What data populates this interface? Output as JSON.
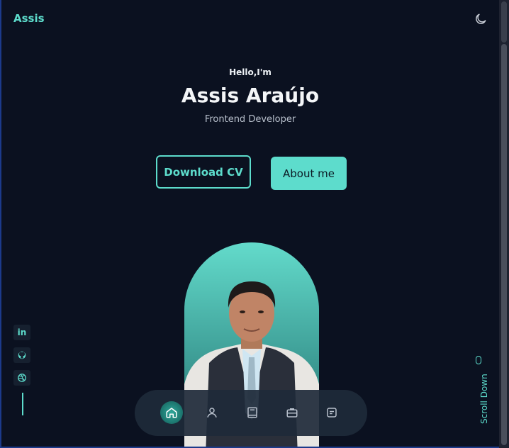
{
  "header": {
    "brand": "Assis",
    "theme_toggle_icon": "moon-icon"
  },
  "hero": {
    "greeting": "Hello,I'm",
    "name": "Assis Araújo",
    "role": "Frontend Developer",
    "download_cv_label": "Download CV",
    "about_label": "About me"
  },
  "social": [
    {
      "name": "linkedin-icon",
      "glyph": "in"
    },
    {
      "name": "github-icon",
      "glyph": ""
    },
    {
      "name": "dribbble-icon",
      "glyph": ""
    }
  ],
  "scroll": {
    "label": "Scroll Down"
  },
  "nav": {
    "items": [
      {
        "name": "home-icon",
        "active": true
      },
      {
        "name": "user-icon",
        "active": false
      },
      {
        "name": "book-icon",
        "active": false
      },
      {
        "name": "briefcase-icon",
        "active": false
      },
      {
        "name": "message-icon",
        "active": false
      }
    ]
  },
  "colors": {
    "accent": "#5ddccc",
    "background": "#0b1120",
    "nav_bg": "#1e2a3a"
  }
}
